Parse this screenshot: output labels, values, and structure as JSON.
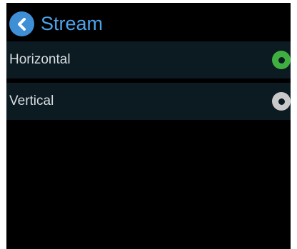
{
  "header": {
    "back_icon": "chevron-left-icon",
    "title": "Stream"
  },
  "options": [
    {
      "label": "Horizontal",
      "selected": true
    },
    {
      "label": "Vertical",
      "selected": false
    }
  ],
  "colors": {
    "accent": "#4da3ea",
    "back_button": "#3f8fd6",
    "selected_radio": "#3fb040",
    "unselected_radio": "#c9c9c9",
    "row_background": "#0c1a22",
    "screen_background": "#000000"
  }
}
